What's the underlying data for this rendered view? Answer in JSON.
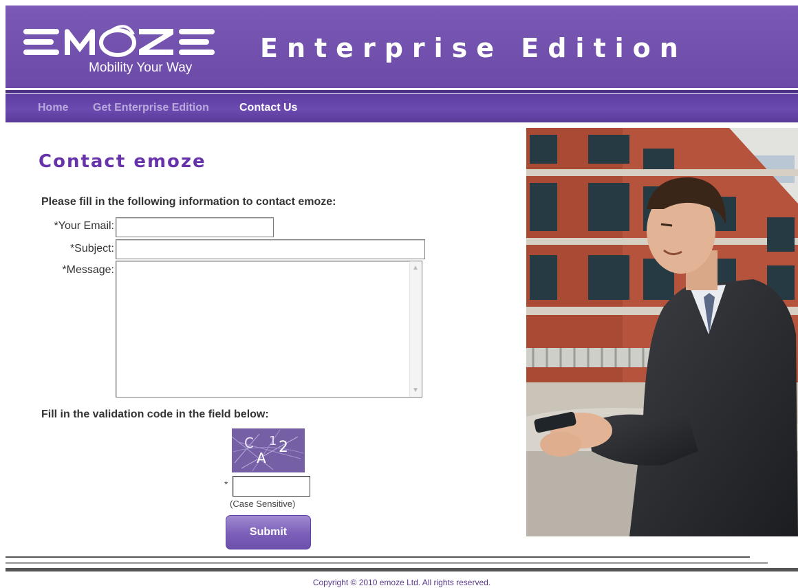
{
  "header": {
    "logo_text": "EMOZE",
    "logo_tagline": "Mobility Your Way",
    "edition_title": "Enterprise Edition"
  },
  "nav": {
    "items": [
      {
        "label": "Home",
        "active": false
      },
      {
        "label": "Get Enterprise Edition",
        "active": false
      },
      {
        "label": "Contact Us",
        "active": true
      }
    ]
  },
  "contact": {
    "title": "Contact emoze",
    "intro": "Please fill in the following information to contact emoze:",
    "email_label": "*Your Email:",
    "email_value": "",
    "subject_label": "*Subject:",
    "subject_value": "",
    "message_label": "*Message:",
    "message_value": "",
    "validation_prompt": "Fill in the validation code in the field below:",
    "captcha_text": "CA12",
    "captcha_required_mark": "*",
    "captcha_value": "",
    "case_note": "(Case Sensitive)",
    "submit_label": "Submit"
  },
  "footer": {
    "copyright": "Copyright © 2010 emoze Ltd. All rights reserved."
  },
  "colors": {
    "header_purple": "#7052b0",
    "nav_purple": "#6040a2",
    "title_purple": "#6633aa",
    "button_purple": "#7b5fb8"
  }
}
